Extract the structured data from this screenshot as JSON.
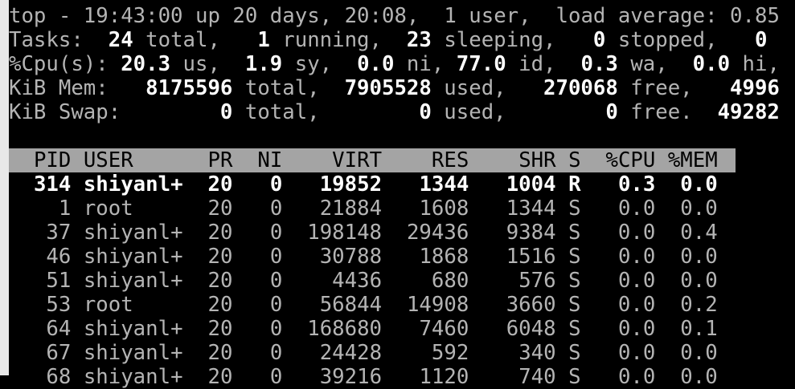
{
  "summary": [
    [
      [
        "l",
        "top - "
      ],
      [
        "l",
        "19:43:00"
      ],
      [
        "l",
        " up "
      ],
      [
        "l",
        "20 days, 20:08"
      ],
      [
        "l",
        ",  "
      ],
      [
        "l",
        "1 user"
      ],
      [
        "l",
        ",  load average: "
      ],
      [
        "l",
        "0.85"
      ]
    ],
    [
      [
        "l",
        "Tasks: "
      ],
      [
        "v",
        " 24"
      ],
      [
        "l",
        " total,   "
      ],
      [
        "v",
        "1"
      ],
      [
        "l",
        " running,  "
      ],
      [
        "v",
        "23"
      ],
      [
        "l",
        " sleeping,   "
      ],
      [
        "v",
        "0"
      ],
      [
        "l",
        " stopped,   "
      ],
      [
        "v",
        "0"
      ]
    ],
    [
      [
        "l",
        "%Cpu(s): "
      ],
      [
        "v",
        "20.3"
      ],
      [
        "l",
        " us,  "
      ],
      [
        "v",
        "1.9"
      ],
      [
        "l",
        " sy,  "
      ],
      [
        "v",
        "0.0"
      ],
      [
        "l",
        " ni, "
      ],
      [
        "v",
        "77.0"
      ],
      [
        "l",
        " id,  "
      ],
      [
        "v",
        "0.3"
      ],
      [
        "l",
        " wa,  "
      ],
      [
        "v",
        "0.0"
      ],
      [
        "l",
        " hi,"
      ]
    ],
    [
      [
        "l",
        "KiB Mem:   "
      ],
      [
        "v",
        "8175596"
      ],
      [
        "l",
        " total,  "
      ],
      [
        "v",
        "7905528"
      ],
      [
        "l",
        " used,   "
      ],
      [
        "v",
        "270068"
      ],
      [
        "l",
        " free,   "
      ],
      [
        "v",
        "4996"
      ]
    ],
    [
      [
        "l",
        "KiB Swap:        "
      ],
      [
        "v",
        "0"
      ],
      [
        "l",
        " total,        "
      ],
      [
        "v",
        "0"
      ],
      [
        "l",
        " used,        "
      ],
      [
        "v",
        "0"
      ],
      [
        "l",
        " free.  "
      ],
      [
        "v",
        "49282"
      ]
    ]
  ],
  "columns": [
    "PID",
    "USER",
    "PR",
    "NI",
    "VIRT",
    "RES",
    "SHR",
    "S",
    "%CPU",
    "%MEM"
  ],
  "processes": [
    [
      "314",
      "shiyanl+",
      "20",
      "0",
      "19852",
      "1344",
      "1004",
      "R",
      "0.3",
      "0.0"
    ],
    [
      "1",
      "root",
      "20",
      "0",
      "21884",
      "1608",
      "1344",
      "S",
      "0.0",
      "0.0"
    ],
    [
      "37",
      "shiyanl+",
      "20",
      "0",
      "198148",
      "29436",
      "9384",
      "S",
      "0.0",
      "0.4"
    ],
    [
      "46",
      "shiyanl+",
      "20",
      "0",
      "30788",
      "1868",
      "1516",
      "S",
      "0.0",
      "0.0"
    ],
    [
      "51",
      "shiyanl+",
      "20",
      "0",
      "4436",
      "680",
      "576",
      "S",
      "0.0",
      "0.0"
    ],
    [
      "53",
      "root",
      "20",
      "0",
      "56844",
      "14908",
      "3660",
      "S",
      "0.0",
      "0.2"
    ],
    [
      "64",
      "shiyanl+",
      "20",
      "0",
      "168680",
      "7460",
      "6048",
      "S",
      "0.0",
      "0.1"
    ],
    [
      "67",
      "shiyanl+",
      "20",
      "0",
      "24428",
      "592",
      "340",
      "S",
      "0.0",
      "0.0"
    ],
    [
      "68",
      "shiyanl+",
      "20",
      "0",
      "39216",
      "1120",
      "740",
      "S",
      "0.0",
      "0.0"
    ]
  ]
}
